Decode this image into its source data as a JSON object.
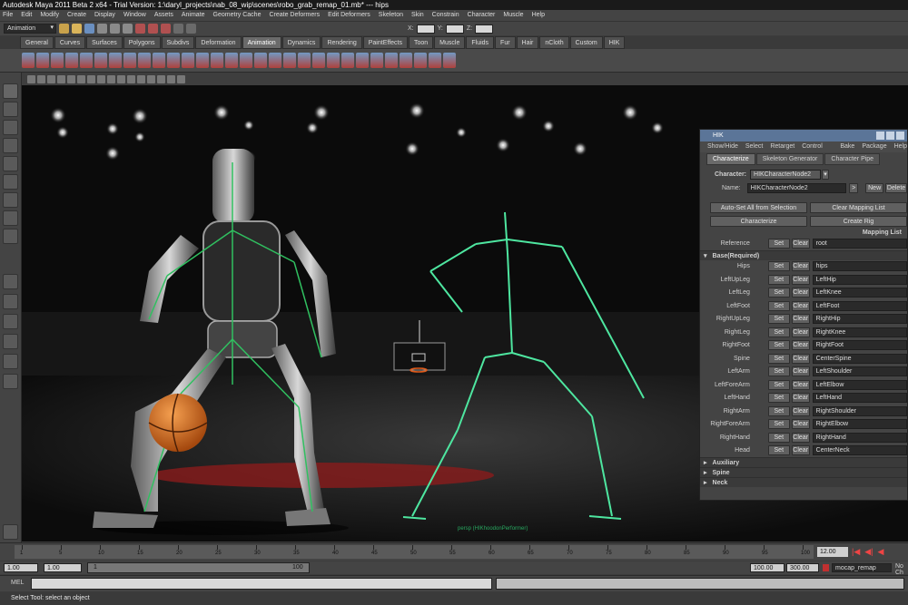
{
  "window": {
    "title": "Autodesk Maya 2011 Beta 2 x64 - Trial Version: 1:\\daryl_projects\\nab_08_wip\\scenes\\robo_grab_remap_01.mb*    ---    hips"
  },
  "menubar": [
    "File",
    "Edit",
    "Modify",
    "Create",
    "Display",
    "Window",
    "Assets",
    "Animate",
    "Geometry Cache",
    "Create Deformers",
    "Edit Deformers",
    "Skeleton",
    "Skin",
    "Constrain",
    "Character",
    "Muscle",
    "Help"
  ],
  "status_line": {
    "mode": "Animation",
    "x_label": "X:",
    "y_label": "Y:",
    "z_label": "Z:"
  },
  "shelf_tabs": [
    "General",
    "Curves",
    "Surfaces",
    "Polygons",
    "Subdivs",
    "Deformation",
    "Animation",
    "Dynamics",
    "Rendering",
    "PaintEffects",
    "Toon",
    "Muscle",
    "Fluids",
    "Fur",
    "Hair",
    "nCloth",
    "Custom",
    "HIK"
  ],
  "active_shelf": "Animation",
  "viewport": {
    "camera_label": "persp (HIKhoodonPerformer)"
  },
  "hik": {
    "title": "HIK",
    "menu": [
      "Show/Hide",
      "Select",
      "Retarget",
      "Control Rig",
      "Bake",
      "Package",
      "Help"
    ],
    "tabs": [
      "Characterize",
      "Skeleton Generator",
      "Character Pipe"
    ],
    "character_label": "Character:",
    "character_value": "HIKCharacterNode2",
    "name_label": "Name:",
    "name_value": "HIKCharacterNode2",
    "arrow_btn": ">",
    "new_btn": "New",
    "delete_btn": "Delete",
    "auto_set_btn": "Auto-Set All from Selection",
    "clear_mapping_btn": "Clear Mapping List",
    "characterize_btn": "Characterize",
    "create_rig_btn": "Create Rig",
    "mapping_list_label": "Mapping List",
    "reference_label": "Reference",
    "reference_value": "root",
    "set_label": "Set",
    "clear_label": "Clear",
    "base_section": "Base(Required)",
    "mapping": [
      {
        "label": "Hips",
        "value": "hips"
      },
      {
        "label": "LeftUpLeg",
        "value": "LeftHip"
      },
      {
        "label": "LeftLeg",
        "value": "LeftKnee"
      },
      {
        "label": "LeftFoot",
        "value": "LeftFoot"
      },
      {
        "label": "RightUpLeg",
        "value": "RightHip"
      },
      {
        "label": "RightLeg",
        "value": "RightKnee"
      },
      {
        "label": "RightFoot",
        "value": "RightFoot"
      },
      {
        "label": "Spine",
        "value": "CenterSpine"
      },
      {
        "label": "LeftArm",
        "value": "LeftShoulder"
      },
      {
        "label": "LeftForeArm",
        "value": "LeftElbow"
      },
      {
        "label": "LeftHand",
        "value": "LeftHand"
      },
      {
        "label": "RightArm",
        "value": "RightShoulder"
      },
      {
        "label": "RightForeArm",
        "value": "RightElbow"
      },
      {
        "label": "RightHand",
        "value": "RightHand"
      },
      {
        "label": "Head",
        "value": "CenterNeck"
      }
    ],
    "sections": [
      "Auxiliary",
      "Spine",
      "Neck"
    ]
  },
  "timeline": {
    "ticks": [
      "1",
      "5",
      "10",
      "15",
      "20",
      "25",
      "30",
      "35",
      "40",
      "45",
      "50",
      "55",
      "60",
      "65",
      "70",
      "75",
      "80",
      "85",
      "90",
      "95",
      "100"
    ],
    "current_frame": "12.00"
  },
  "range": {
    "start": "1.00",
    "inner_start": "1.00",
    "slider_start": "1",
    "slider_end": "100",
    "inner_end": "100.00",
    "end": "300.00",
    "anim_layer": "mocap_remap",
    "char_label": "No Ch"
  },
  "command": {
    "label": "MEL"
  },
  "help_line": "Select Tool: select an object"
}
